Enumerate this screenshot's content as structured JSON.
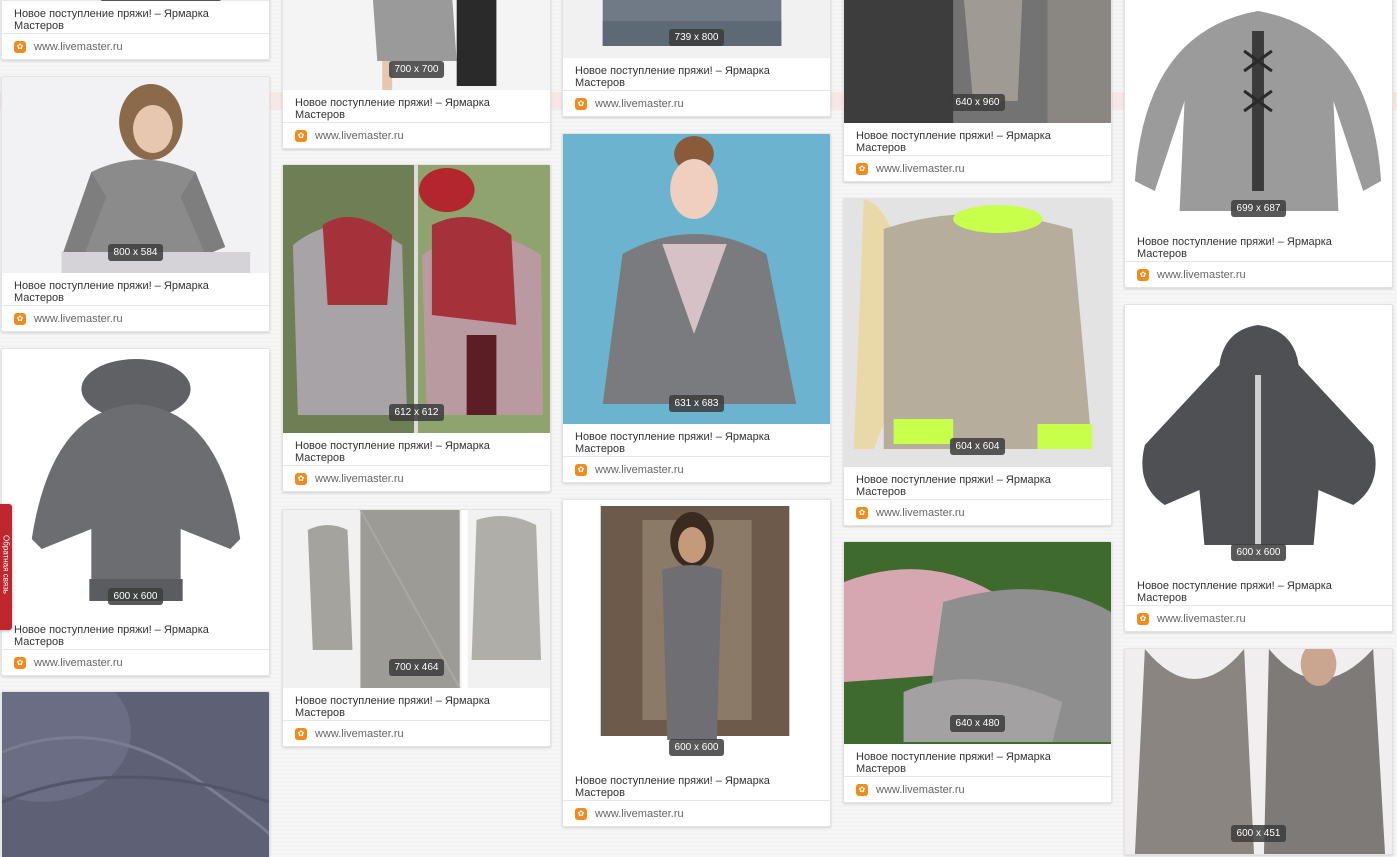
{
  "caption": "Новое поступление пряжи! – Ярмарка Мастеров",
  "source_domain": "www.livemaster.ru",
  "side_tab_label": "Обратная связь",
  "columns": [
    {
      "cards": [
        {
          "dims": "",
          "tone": "#cfcfcf"
        },
        {
          "dims": "800 x 584",
          "tone": "#8b8b8b"
        },
        {
          "dims": "600 x 600",
          "tone": "#6b6d70"
        },
        {
          "dims": "",
          "tone": "#5e6175"
        }
      ]
    },
    {
      "cards": [
        {
          "dims": "700 x 700",
          "tone": "#9a9a9a"
        },
        {
          "dims": "612 x 612",
          "tone": "#8c3a3e"
        },
        {
          "dims": "700 x 464",
          "tone": "#a5a39e"
        }
      ]
    },
    {
      "cards": [
        {
          "dims": "739 x 800",
          "tone": "#6f7a86"
        },
        {
          "dims": "631 x 683",
          "tone": "#6bb3cf"
        },
        {
          "dims": "600 x 600",
          "tone": "#6e6e73"
        }
      ]
    },
    {
      "cards": [
        {
          "dims": "640 x 960",
          "tone": "#737373"
        },
        {
          "dims": "604 x 604",
          "tone": "#b7ad9c"
        },
        {
          "dims": "640 x 480",
          "tone": "#d6a7b0"
        }
      ]
    },
    {
      "cards": [
        {
          "dims": "699 x 687",
          "tone": "#9b9b9b"
        },
        {
          "dims": "600 x 600",
          "tone": "#4f5054"
        },
        {
          "dims": "600 x 451",
          "tone": "#8b8582"
        }
      ]
    }
  ]
}
